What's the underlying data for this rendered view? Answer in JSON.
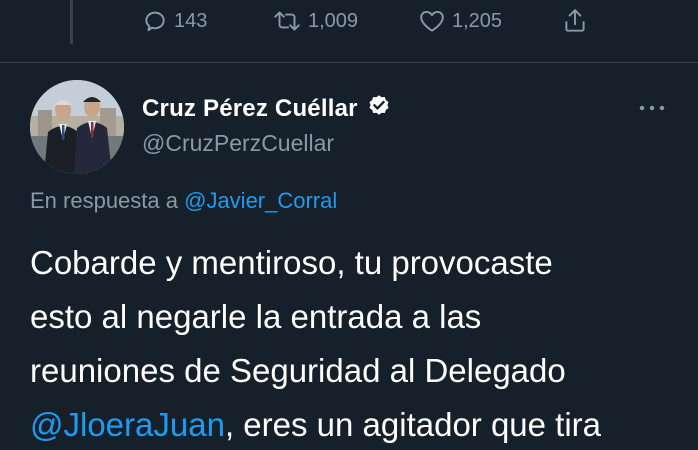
{
  "actions": {
    "reply_count": "143",
    "retweet_count": "1,009",
    "like_count": "1,205"
  },
  "author": {
    "name": "Cruz Pérez Cuéllar",
    "handle": "@CruzPerzCuellar"
  },
  "reply_to": {
    "prefix": "En respuesta a",
    "mention": "@Javier_Corral"
  },
  "tweet": {
    "line1": "Cobarde y mentiroso, tu provocaste",
    "line2": "esto al negarle la entrada a las",
    "line3": "reuniones de Seguridad al Delegado",
    "mention": "@JloeraJuan",
    "line4_rest": ", eres un agitador que tira"
  },
  "colors": {
    "background": "#15202b",
    "muted_text": "#8b98a5",
    "link": "#1d9bf0",
    "divider": "#38444d"
  },
  "icons": {
    "reply": "reply-icon",
    "retweet": "retweet-icon",
    "like": "heart-icon",
    "share": "share-icon",
    "verified": "verified-badge-icon",
    "more": "more-options-icon"
  }
}
